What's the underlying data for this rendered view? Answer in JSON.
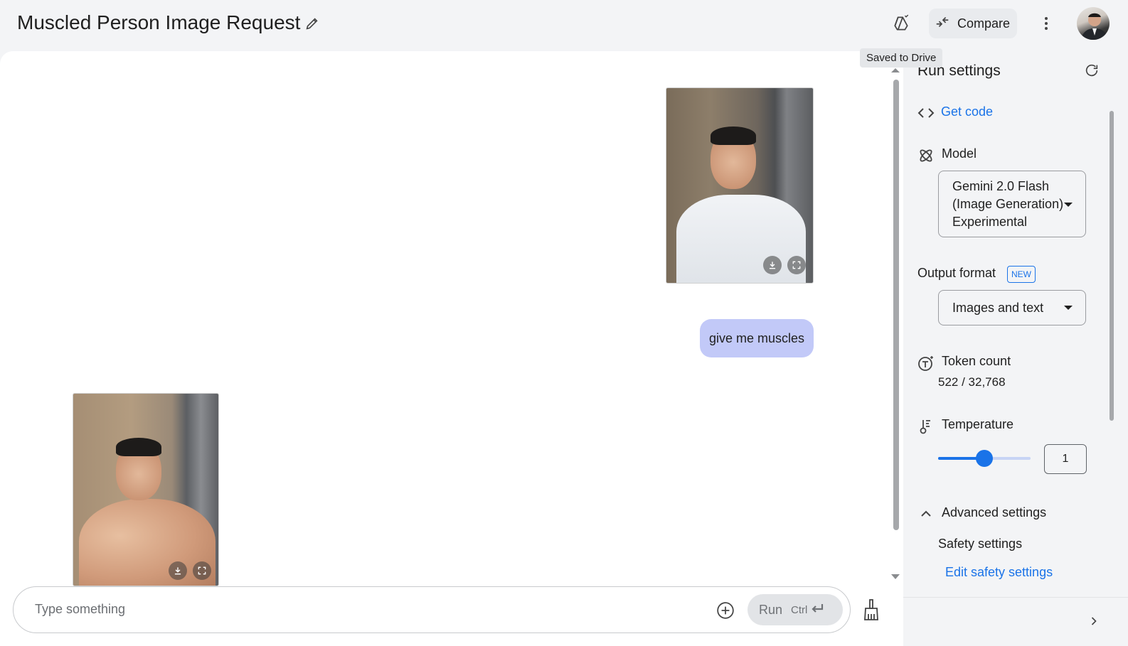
{
  "header": {
    "title": "Muscled Person Image Request",
    "compare_label": "Compare",
    "drive_tooltip": "Saved to Drive"
  },
  "chat": {
    "user_message": "give me muscles",
    "input_placeholder": "Type something",
    "run_label": "Run",
    "run_shortcut": "Ctrl"
  },
  "settings": {
    "title": "Run settings",
    "get_code": "Get code",
    "model_label": "Model",
    "model_value_lines": [
      "Gemini 2.0 Flash",
      "(Image Generation)",
      "Experimental"
    ],
    "output_format_label": "Output format",
    "new_badge": "NEW",
    "output_format_value": "Images and text",
    "token_count_label": "Token count",
    "token_count_value": "522 / 32,768",
    "temperature_label": "Temperature",
    "temperature_value": "1",
    "temperature_fraction": 0.5,
    "advanced_label": "Advanced settings",
    "safety_label": "Safety settings",
    "edit_safety": "Edit safety settings"
  },
  "colors": {
    "accent": "#1a73e8",
    "bubble": "#c2c9f8",
    "background": "#f3f4f6"
  },
  "icons": [
    "pencil-icon",
    "drive-saved-icon",
    "compare-icon",
    "more-vert-icon",
    "refresh-icon",
    "code-icon",
    "model-icon",
    "token-icon",
    "temperature-icon",
    "chevron-up-icon",
    "add-circle-icon",
    "enter-icon",
    "broom-icon",
    "download-icon",
    "fullscreen-icon",
    "chevron-right-icon"
  ]
}
